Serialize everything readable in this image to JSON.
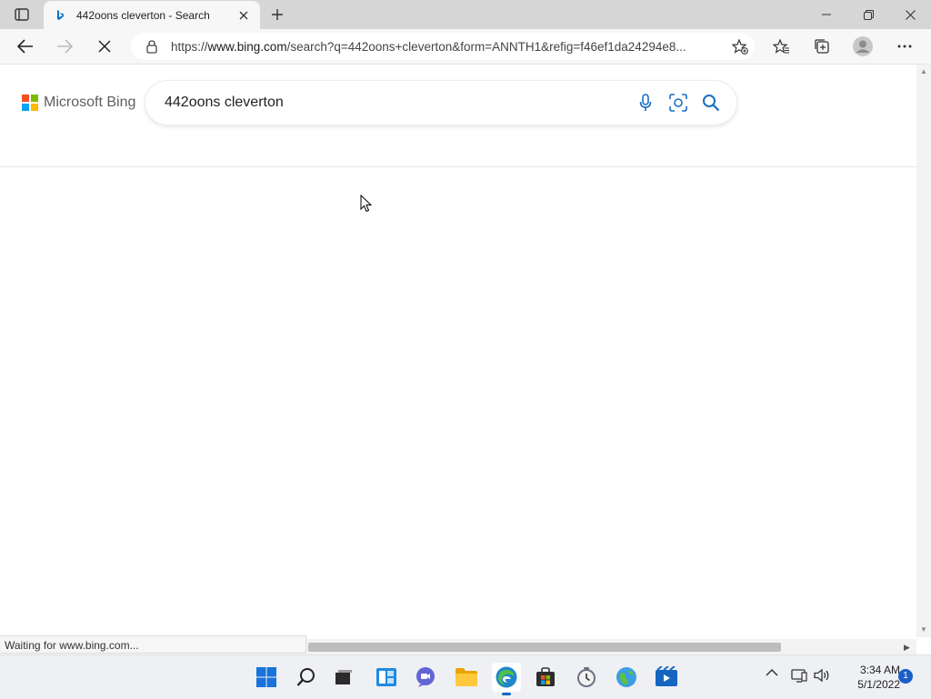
{
  "browser": {
    "tab": {
      "title": "442oons cleverton - Search",
      "favicon": "bing-favicon"
    },
    "address_bar": {
      "url_prefix": "https://",
      "url_host": "www.bing.com",
      "url_rest": "/search?q=442oons+cleverton&form=ANNTH1&refig=f46ef1da24294e8..."
    },
    "status_text": "Waiting for www.bing.com..."
  },
  "bing": {
    "brand_name": "Microsoft Bing",
    "search_query": "442oons cleverton",
    "logo_colors": [
      "#f25022",
      "#7fba00",
      "#00a4ef",
      "#ffb900"
    ]
  },
  "taskbar": {
    "apps": [
      "windows-start",
      "search",
      "task-view",
      "widgets",
      "teams-chat",
      "file-explorer",
      "edge",
      "store",
      "clock-app",
      "maps",
      "movies"
    ],
    "clock": {
      "time": "3:34 AM",
      "date": "5/1/2022"
    },
    "notification_count": "1"
  },
  "colors": {
    "accent": "#1668c8",
    "bing_icon_blue": "#1b6ec2"
  }
}
